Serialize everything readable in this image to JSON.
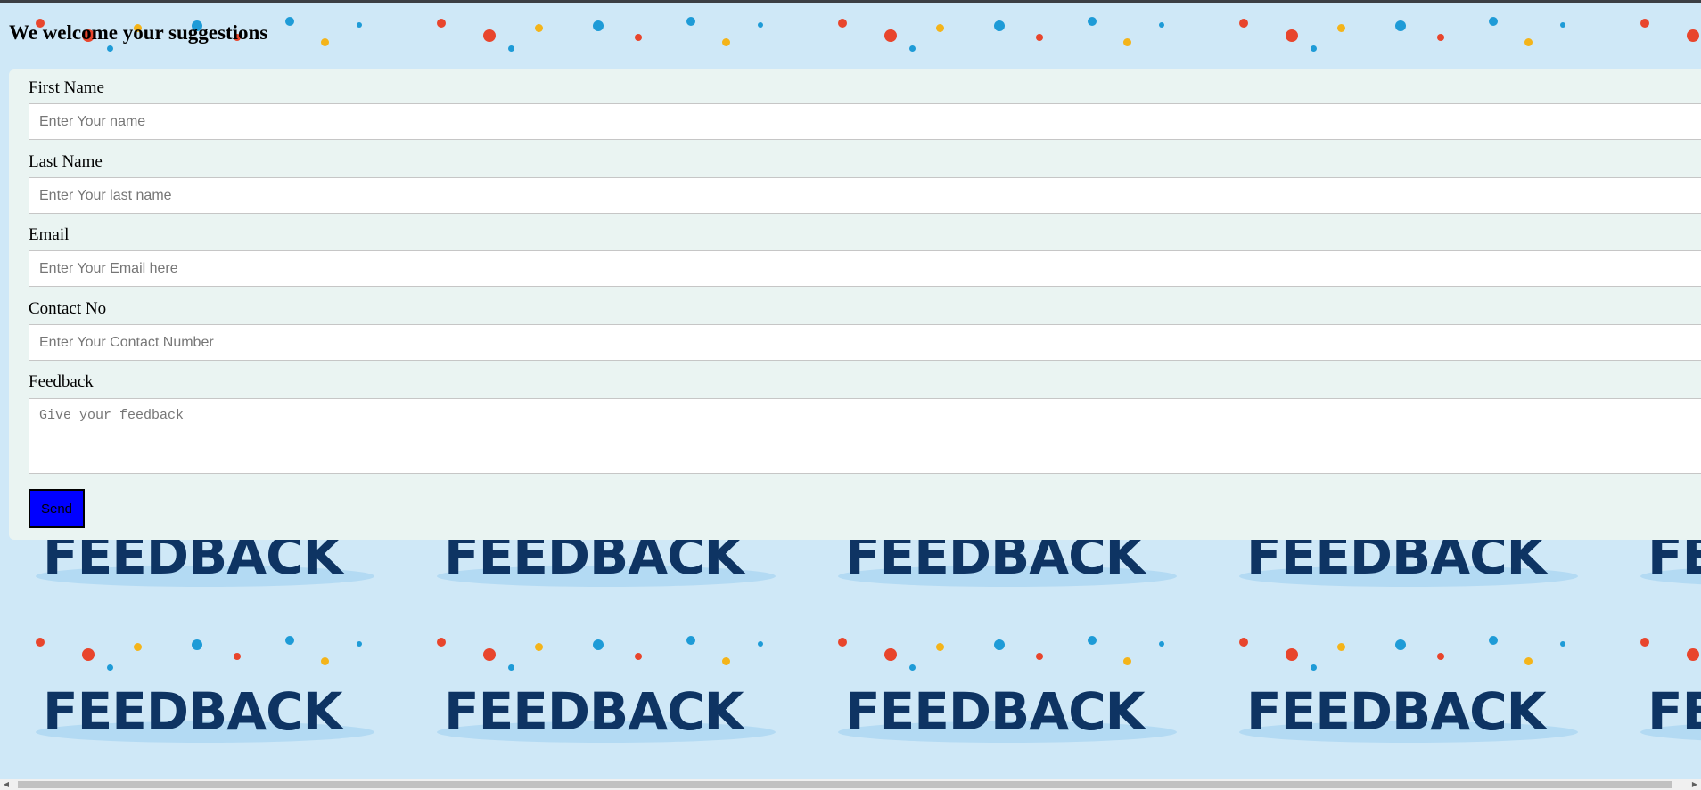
{
  "heading": "We welcome your suggestions",
  "background": {
    "tile_word": "FEEDBACK"
  },
  "form": {
    "first_name": {
      "label": "First Name",
      "placeholder": "Enter Your name"
    },
    "last_name": {
      "label": "Last Name",
      "placeholder": "Enter Your last name"
    },
    "email": {
      "label": "Email",
      "placeholder": "Enter Your Email here"
    },
    "contact": {
      "label": "Contact No",
      "placeholder": "Enter Your Contact Number"
    },
    "feedback": {
      "label": "Feedback",
      "placeholder": "Give your feedback"
    },
    "send_label": "Send"
  },
  "colors": {
    "page_background": "#cfe8f7",
    "form_background": "#eaf4f2",
    "send_button": "#0000ff",
    "banner_text": "#0e3463"
  },
  "icons": [
    "scroll-left-arrow-icon",
    "scroll-right-arrow-icon"
  ]
}
